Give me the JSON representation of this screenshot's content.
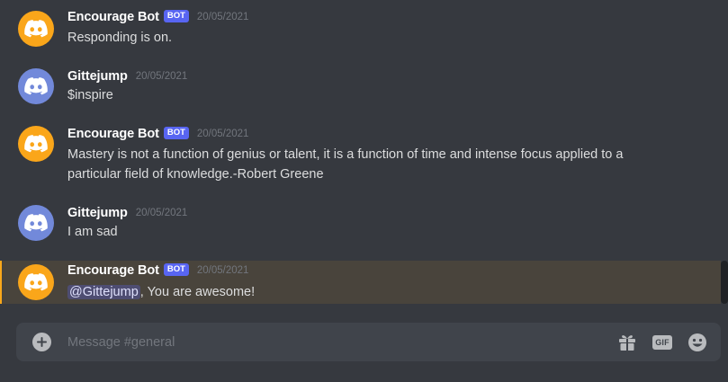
{
  "channel": {
    "name": "general"
  },
  "messages": [
    {
      "author": "Encourage Bot",
      "is_bot": true,
      "bot_tag": "BOT",
      "timestamp": "20/05/2021",
      "avatar_icon": "discord-logo-icon",
      "avatar_color": "#faa61a",
      "content": "Responding is on."
    },
    {
      "author": "Gittejump",
      "is_bot": false,
      "timestamp": "20/05/2021",
      "avatar_icon": "discord-logo-icon",
      "avatar_color": "#7289da",
      "content": "$inspire"
    },
    {
      "author": "Encourage Bot",
      "is_bot": true,
      "bot_tag": "BOT",
      "timestamp": "20/05/2021",
      "avatar_icon": "discord-logo-icon",
      "avatar_color": "#faa61a",
      "content_line1": "Mastery is not a function of genius or talent, it is a function of time and intense focus applied to a",
      "content_line2": "particular field of knowledge.-Robert Greene"
    },
    {
      "author": "Gittejump",
      "is_bot": false,
      "timestamp": "20/05/2021",
      "avatar_icon": "discord-logo-icon",
      "avatar_color": "#7289da",
      "content": "I am sad"
    },
    {
      "author": "Encourage Bot",
      "is_bot": true,
      "bot_tag": "BOT",
      "timestamp": "20/05/2021",
      "avatar_icon": "discord-logo-icon",
      "avatar_color": "#faa61a",
      "mention": "@Gittejump",
      "content_after_mention": ", You are awesome!",
      "highlighted": true
    }
  ],
  "composer": {
    "placeholder": "Message #general",
    "value": "",
    "attach_icon": "plus-circle-icon",
    "gift_icon": "gift-icon",
    "gif_label": "GIF",
    "emoji_icon": "smiley-emoji-icon"
  },
  "colors": {
    "background": "#36393f",
    "composer_bg": "#40444b",
    "mention_highlight_bg": "#49443c",
    "mention_highlight_border": "#faa81a",
    "bot_tag_bg": "#5865f2",
    "timestamp": "#72767d"
  }
}
